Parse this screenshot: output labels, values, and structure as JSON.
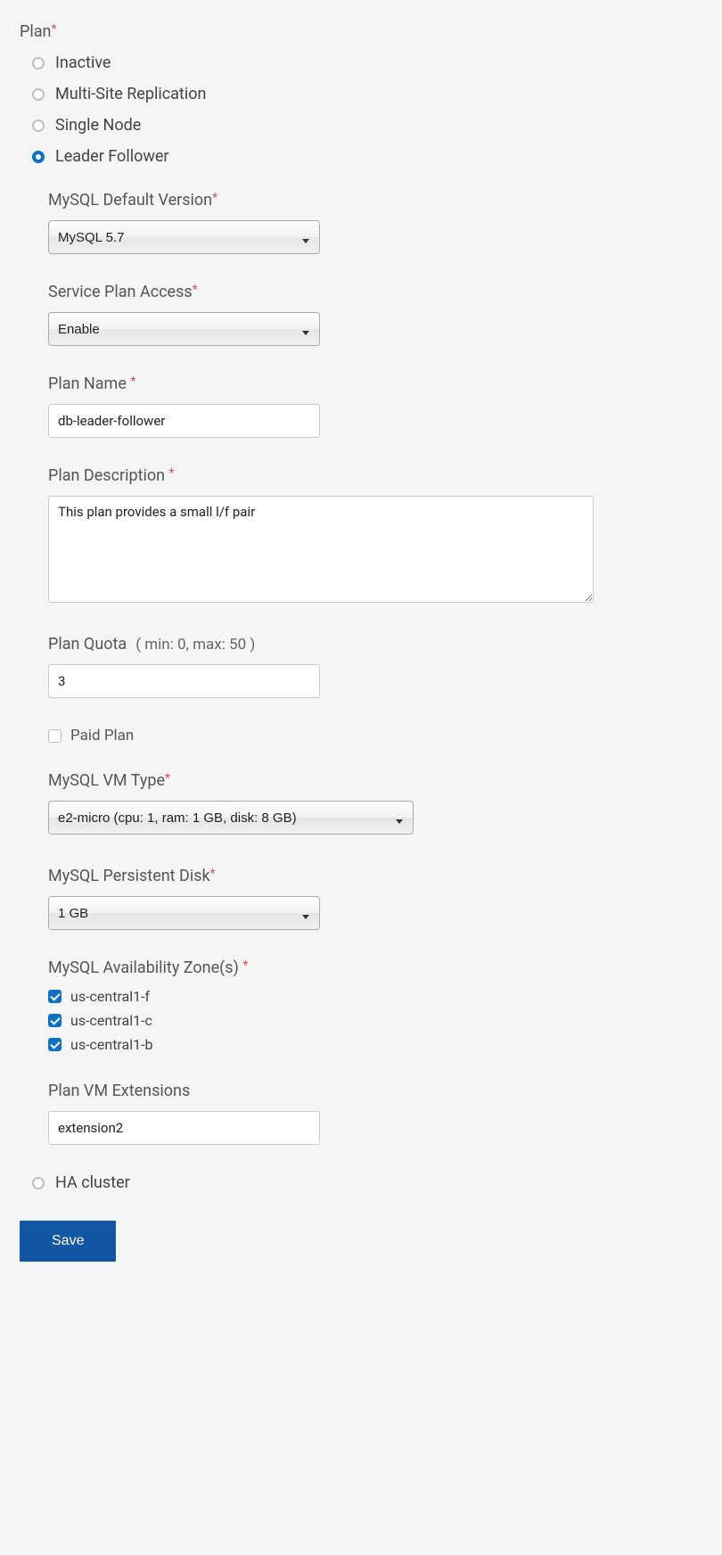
{
  "plan_section": {
    "label": "Plan",
    "options": [
      "Inactive",
      "Multi-Site Replication",
      "Single Node",
      "Leader Follower"
    ],
    "selected": "Leader Follower",
    "ha_option": "HA cluster"
  },
  "fields": {
    "mysql_version": {
      "label": "MySQL Default Version",
      "value": "MySQL 5.7"
    },
    "service_plan_access": {
      "label": "Service Plan Access",
      "value": "Enable"
    },
    "plan_name": {
      "label": "Plan Name ",
      "value": "db-leader-follower"
    },
    "plan_description": {
      "label": "Plan Description ",
      "value": "This plan provides a small l/f pair"
    },
    "plan_quota": {
      "label": "Plan Quota",
      "hint": "( min: 0, max: 50 )",
      "value": "3"
    },
    "paid_plan": {
      "label": "Paid Plan",
      "checked": false
    },
    "vm_type": {
      "label": "MySQL VM Type",
      "value": "e2-micro (cpu: 1, ram: 1 GB, disk: 8 GB)"
    },
    "persistent_disk": {
      "label": "MySQL Persistent Disk",
      "value": "1 GB"
    },
    "az": {
      "label": "MySQL Availability Zone(s) ",
      "zones": [
        {
          "name": "us-central1-f",
          "checked": true
        },
        {
          "name": "us-central1-c",
          "checked": true
        },
        {
          "name": "us-central1-b",
          "checked": true
        }
      ]
    },
    "vm_extensions": {
      "label": "Plan VM Extensions",
      "value": "extension2"
    }
  },
  "save_label": "Save"
}
